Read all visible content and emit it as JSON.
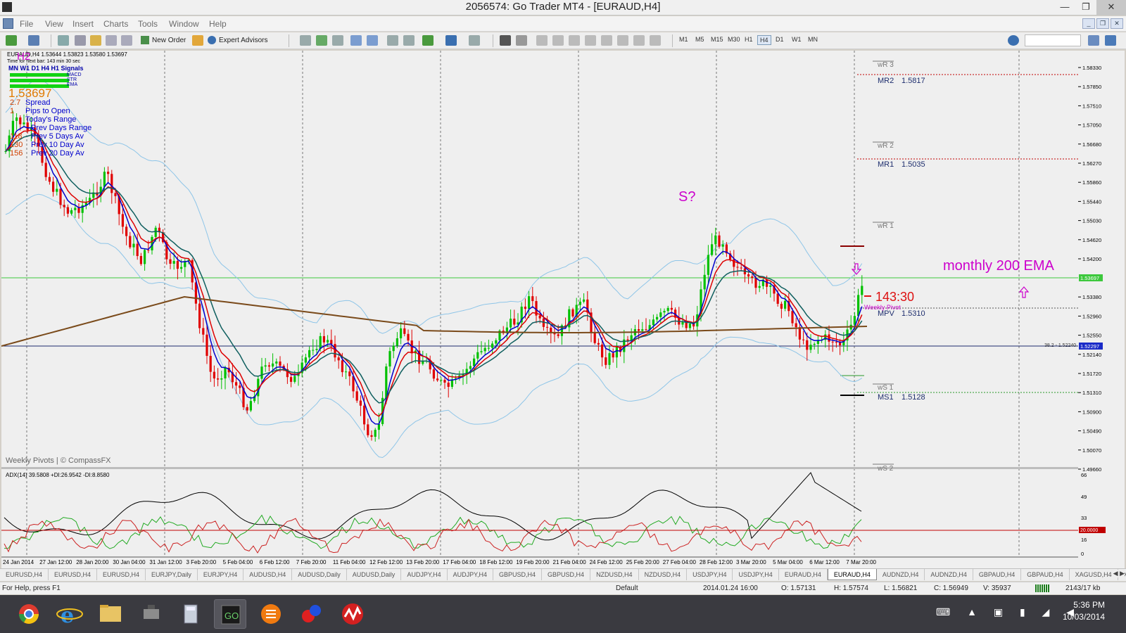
{
  "window": {
    "title": "2056574: Go Trader MT4 - [EURAUD,H4]",
    "minimize": "—",
    "maximize": "❐",
    "close": "✕"
  },
  "menu": {
    "items": [
      "File",
      "View",
      "Insert",
      "Charts",
      "Tools",
      "Window",
      "Help"
    ]
  },
  "toolbar": {
    "new_order": "New Order",
    "expert_advisors": "Expert Advisors",
    "timeframes": [
      "M1",
      "M5",
      "M15",
      "M30",
      "H1",
      "H4",
      "D1",
      "W1",
      "MN"
    ],
    "active_timeframe": "H4"
  },
  "chart": {
    "header": "EURAUD,H4  1.53644 1.53823 1.53580 1.53697",
    "timer_line": "Time for next bar: 143 min 30 sec",
    "signals_header": "MN W1 D1  H4  H1  Signals",
    "signal_rows": [
      "MACD",
      "STR",
      "EMA"
    ],
    "big_price": "1.53697",
    "info_rows": [
      {
        "value": "2.7",
        "label": "Spread"
      },
      {
        "value": "1",
        "label": "Pips to Open"
      },
      {
        "value": "",
        "label": "Today's Range"
      },
      {
        "value": "",
        "label": "Prev Days Range"
      },
      {
        "value": "118",
        "label": "Prev 5 Days Av"
      },
      {
        "value": "130",
        "label": "Prev 10 Day Av"
      },
      {
        "value": "156",
        "label": "Prev 20 Day Av"
      }
    ],
    "corner_mark": "H2",
    "footer_note": "Weekly Pivots | © CompassFX",
    "annotations": {
      "s_question": "S?",
      "monthly_ema": "monthly 200 EMA",
      "countdown": "143:30",
      "weekly_pivot": "Weekly Pivot"
    },
    "pivots": [
      {
        "label": "wR 3",
        "value": ""
      },
      {
        "label": "MR2",
        "value": "1.5817"
      },
      {
        "label": "wR 2",
        "value": ""
      },
      {
        "label": "MR1",
        "value": "1.5035"
      },
      {
        "label": "wR 1",
        "value": ""
      },
      {
        "label": "MPV",
        "value": "1.5310"
      },
      {
        "label": "wS 1",
        "value": ""
      },
      {
        "label": "MS1",
        "value": "1.5128"
      },
      {
        "label": "wS 2",
        "value": ""
      }
    ],
    "fib_label": "38.2 - 1.52240",
    "price_axis": [
      "1.58330",
      "1.57850",
      "1.57510",
      "1.57050",
      "1.56680",
      "1.56270",
      "1.55860",
      "1.55440",
      "1.55030",
      "1.54620",
      "1.54200",
      "1.53380",
      "1.52960",
      "1.52550",
      "1.52140",
      "1.51720",
      "1.51310",
      "1.50900",
      "1.50490",
      "1.50070",
      "1.49660"
    ],
    "price_current": "1.53697",
    "price_level": "1.52297",
    "time_axis": [
      "24 Jan 2014",
      "27 Jan 12:00",
      "28 Jan 20:00",
      "30 Jan 04:00",
      "31 Jan 12:00",
      "3 Feb 20:00",
      "5 Feb 04:00",
      "6 Feb 12:00",
      "7 Feb 20:00",
      "11 Feb 04:00",
      "12 Feb 12:00",
      "13 Feb 20:00",
      "17 Feb 04:00",
      "18 Feb 12:00",
      "19 Feb 20:00",
      "21 Feb 04:00",
      "24 Feb 12:00",
      "25 Feb 20:00",
      "27 Feb 04:00",
      "28 Feb 12:00",
      "3 Mar 20:00",
      "5 Mar 04:00",
      "6 Mar 12:00",
      "7 Mar 20:00"
    ],
    "adx_header": "ADX(14) 39.5808  +DI:26.9542  -DI:8.8580",
    "adx_axis": [
      "66",
      "49",
      "33",
      "16",
      "0"
    ],
    "adx_level": "20.0000"
  },
  "colors": {
    "bull_candle": "#00c000",
    "bear_candle": "#e00000",
    "ema_fast": "#0000cc",
    "ema_slow": "#dd0000",
    "ema_teal": "#0f5f5f",
    "ema_200": "#7a4a1a",
    "bollinger": "#8ec5e8",
    "pivot_line": "#c00000",
    "annotation": "#cc00cc"
  },
  "tabs": [
    "EURUSD,H4",
    "EURUSD,H4",
    "EURUSD,H4",
    "EURJPY,Daily",
    "EURJPY,H4",
    "AUDUSD,H4",
    "AUDUSD,Daily",
    "AUDUSD,Daily",
    "AUDJPY,H4",
    "AUDJPY,H4",
    "GBPUSD,H4",
    "GBPUSD,H4",
    "NZDUSD,H4",
    "NZDUSD,H4",
    "USDJPY,H4",
    "USDJPY,H4",
    "EURAUD,H4",
    "EURAUD,H4",
    "AUDNZD,H4",
    "AUDNZD,H4",
    "GBPAUD,H4",
    "GBPAUD,H4",
    "XAGUSD,H4",
    "XAG"
  ],
  "active_tab_index": 17,
  "status": {
    "help": "For Help, press F1",
    "profile": "Default",
    "datetime": "2014.01.24 16:00",
    "open": "O: 1.57131",
    "high": "H: 1.57574",
    "low": "L: 1.56821",
    "close": "C: 1.56949",
    "volume": "V: 35937",
    "traffic": "2143/17 kb"
  },
  "taskbar": {
    "time": "5:36 PM",
    "date": "10/03/2014"
  }
}
